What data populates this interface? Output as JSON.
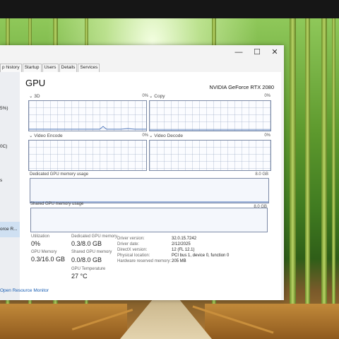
{
  "window": {
    "minimize_glyph": "—",
    "maximize_glyph": "☐",
    "close_glyph": "✕"
  },
  "tabs": [
    "p history",
    "Startup",
    "Users",
    "Details",
    "Services"
  ],
  "sidebar": {
    "items": [
      "5%)",
      "0C)",
      "s",
      "orce R..."
    ]
  },
  "gpu": {
    "title": "GPU",
    "model": "NVIDIA GeForce RTX 2080",
    "graphs": [
      {
        "name": "3D",
        "percent": "0%",
        "load": 0.0
      },
      {
        "name": "Copy",
        "percent": "0%",
        "load": 0.0
      },
      {
        "name": "Video Encode",
        "percent": "0%",
        "load": 0.0
      },
      {
        "name": "Video Decode",
        "percent": "0%",
        "load": 0.0
      }
    ],
    "dedicated_label": "Dedicated GPU memory usage",
    "dedicated_max": "8.0 GB",
    "shared_label": "Shared GPU memory usage",
    "shared_max": "8.0 GB"
  },
  "stats": {
    "utilization_label": "Utilization",
    "utilization_value": "0%",
    "gpu_memory_label": "GPU Memory",
    "gpu_memory_value": "0.3/16.0 GB",
    "dedicated_label": "Dedicated GPU memory",
    "dedicated_value": "0.3/8.0 GB",
    "shared_label": "Shared GPU memory",
    "shared_value": "0.0/8.0 GB",
    "temp_label": "GPU Temperature",
    "temp_value": "27 °C"
  },
  "details": [
    {
      "key": "Driver version:",
      "value": "32.0.15.7242"
    },
    {
      "key": "Driver date:",
      "value": "2/12/2025"
    },
    {
      "key": "DirectX version:",
      "value": "12 (FL 12.1)"
    },
    {
      "key": "Physical location:",
      "value": "PCI bus 1, device 0, function 0"
    },
    {
      "key": "Hardware reserved memory:",
      "value": "205 MB"
    }
  ],
  "footer": {
    "link": "Open Resource Monitor"
  },
  "colors": {
    "graph_border": "#7c8aa6",
    "link": "#1a5fb4"
  }
}
